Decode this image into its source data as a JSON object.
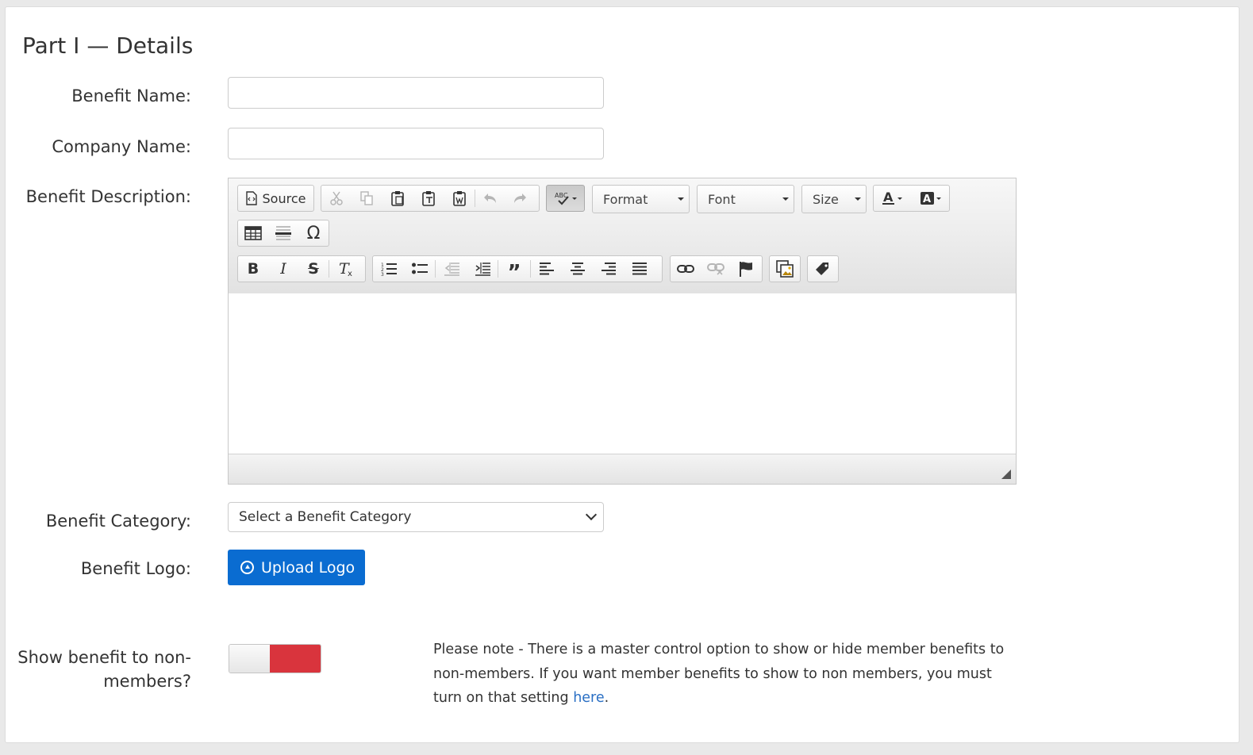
{
  "section": {
    "title": "Part I — Details"
  },
  "form": {
    "benefit_name": {
      "label": "Benefit Name:",
      "value": "",
      "placeholder": ""
    },
    "company_name": {
      "label": "Company Name:",
      "value": "",
      "placeholder": ""
    },
    "benefit_description": {
      "label": "Benefit Description:"
    },
    "benefit_category": {
      "label": "Benefit Category:",
      "selected": "Select a Benefit Category"
    },
    "benefit_logo": {
      "label": "Benefit Logo:",
      "button_label": "Upload Logo"
    },
    "show_to_nonmembers": {
      "label_line1": "Show benefit to non-",
      "label_line2": "members?",
      "state": "off"
    }
  },
  "editor": {
    "toolbar": {
      "source_label": "Source",
      "format_label": "Format",
      "font_label": "Font",
      "size_label": "Size"
    },
    "content": ""
  },
  "note": {
    "text": "Please note - There is a master control option to show or hide member benefits to non-members. If you want member benefits to show to non members, you must turn on that setting ",
    "link_text": "here",
    "suffix": "."
  },
  "colors": {
    "primary_button": "#0a6cd1",
    "toggle_red": "#d9343d",
    "link": "#2a6fc4"
  }
}
